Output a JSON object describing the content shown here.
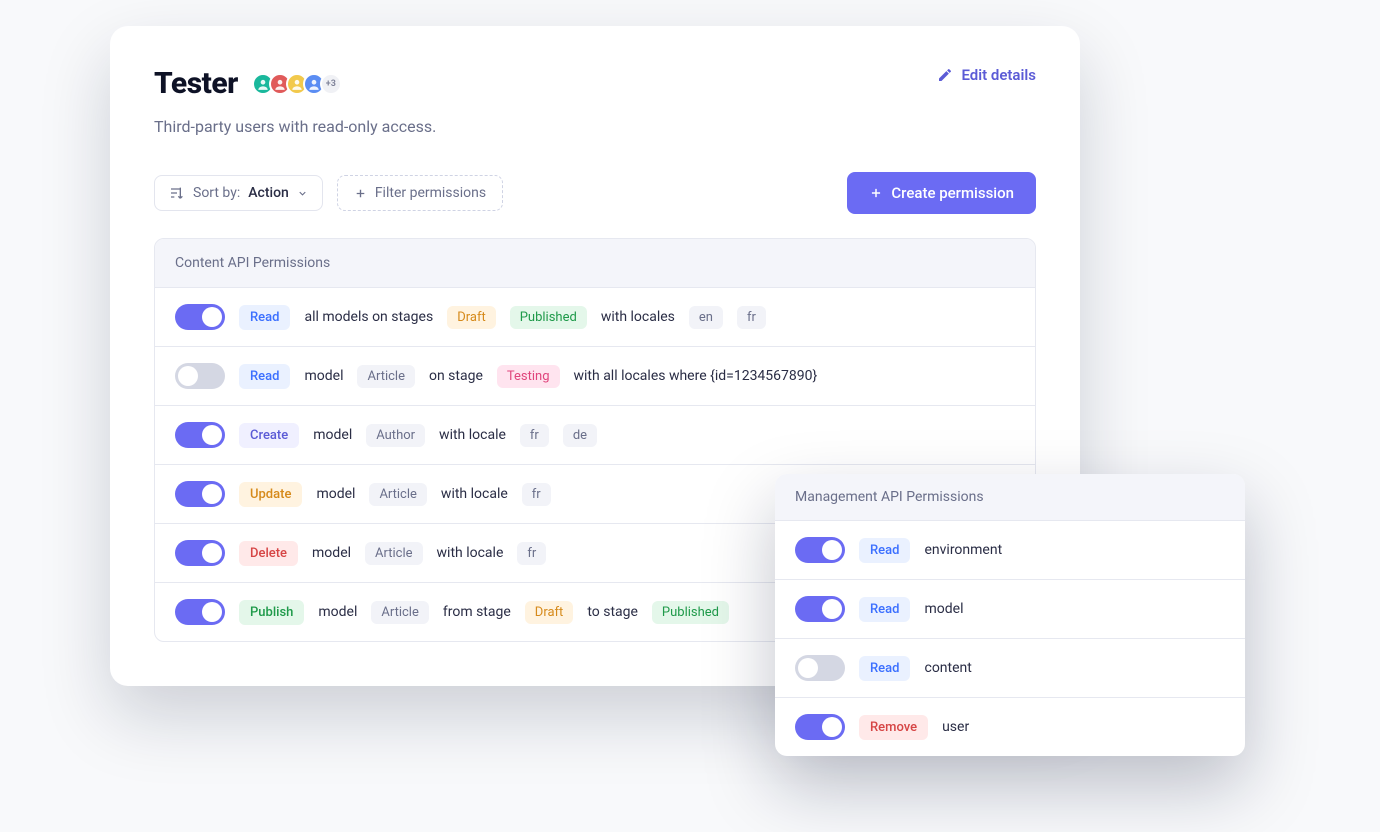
{
  "header": {
    "title": "Tester",
    "subtitle": "Third-party users with read-only access.",
    "avatar_extra": "+3",
    "edit_label": "Edit details"
  },
  "toolbar": {
    "sort_prefix": "Sort by:",
    "sort_value": "Action",
    "filter_label": "Filter permissions",
    "create_label": "Create permission"
  },
  "content": {
    "section_title": "Content API Permissions",
    "rows": [
      {
        "on": true,
        "action": "Read",
        "action_kind": "read",
        "text1": "all models on stages",
        "stage1": "Draft",
        "stage1_kind": "draft",
        "stage2": "Published",
        "stage2_kind": "published",
        "text2": "with locales",
        "locale1": "en",
        "locale2": "fr"
      },
      {
        "on": false,
        "action": "Read",
        "action_kind": "read",
        "text1": "model",
        "model": "Article",
        "text2": "on stage",
        "stage1": "Testing",
        "stage1_kind": "testing",
        "text3": "with all locales where {id=1234567890}"
      },
      {
        "on": true,
        "action": "Create",
        "action_kind": "create",
        "text1": "model",
        "model": "Author",
        "text2": "with locale",
        "locale1": "fr",
        "locale2": "de"
      },
      {
        "on": true,
        "action": "Update",
        "action_kind": "update",
        "text1": "model",
        "model": "Article",
        "text2": "with locale",
        "locale1": "fr"
      },
      {
        "on": true,
        "action": "Delete",
        "action_kind": "delete",
        "text1": "model",
        "model": "Article",
        "text2": "with locale",
        "locale1": "fr"
      },
      {
        "on": true,
        "action": "Publish",
        "action_kind": "publish",
        "text1": "model",
        "model": "Article",
        "text2": "from stage",
        "stage1": "Draft",
        "stage1_kind": "draft",
        "text3": "to stage",
        "stage2": "Published",
        "stage2_kind": "published"
      }
    ]
  },
  "management": {
    "section_title": "Management API Permissions",
    "rows": [
      {
        "on": true,
        "action": "Read",
        "action_kind": "read",
        "text": "environment"
      },
      {
        "on": true,
        "action": "Read",
        "action_kind": "read",
        "text": "model"
      },
      {
        "on": false,
        "action": "Read",
        "action_kind": "read",
        "text": "content"
      },
      {
        "on": true,
        "action": "Remove",
        "action_kind": "remove",
        "text": "user"
      }
    ]
  },
  "avatar_colors": [
    "#1ab89c",
    "#e05a5a",
    "#f2c94c",
    "#5b8df3"
  ]
}
